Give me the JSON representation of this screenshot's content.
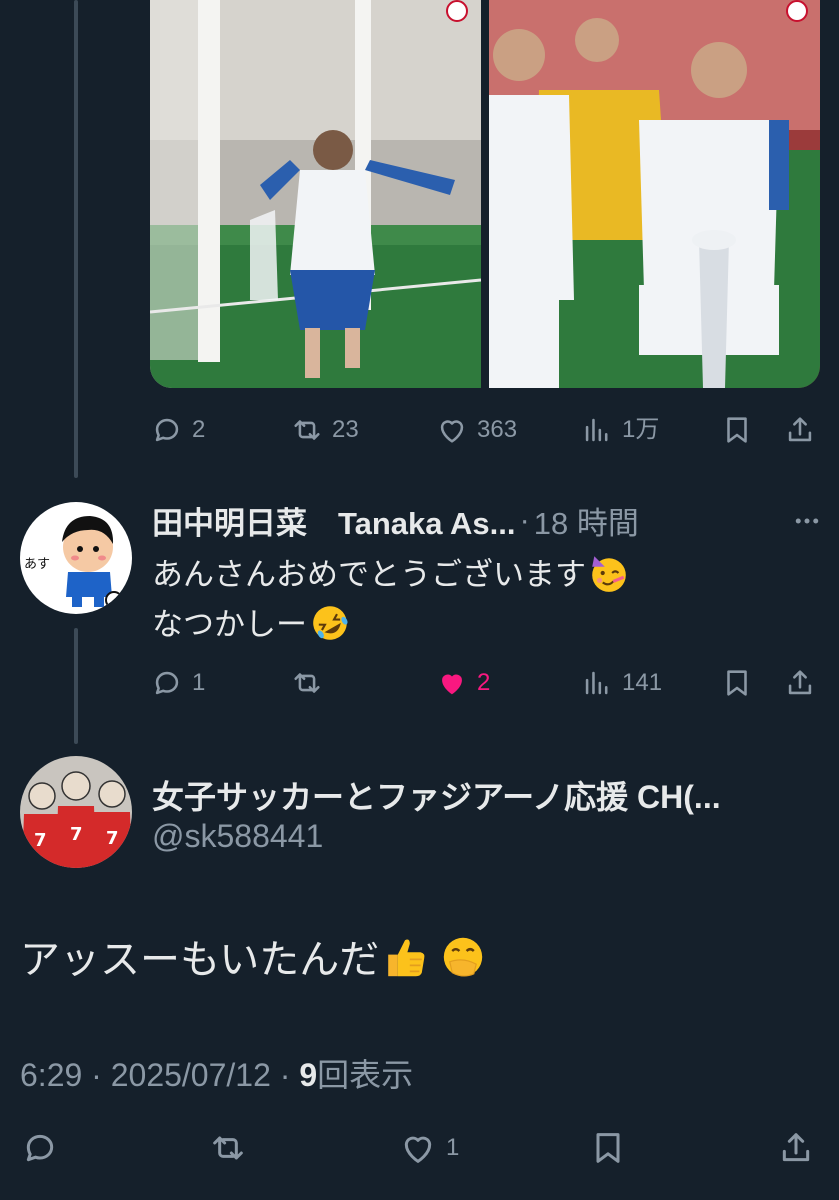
{
  "colors": {
    "background": "#15202b",
    "text": "#e7e9ea",
    "muted": "#8b98a5",
    "like": "#f91880",
    "thread_line": "#3c4a57"
  },
  "quoted_post": {
    "images": [
      "goal-celebration-photo",
      "trophy-celebration-photo"
    ],
    "actions": {
      "replies": "2",
      "reposts": "23",
      "likes": "363",
      "views": "1万"
    }
  },
  "reply": {
    "display_name": "田中明日菜　Tanaka As...",
    "separator": "·",
    "time": "18 時間",
    "avatar_text": "あす",
    "lines": [
      "あんさんおめでとうございます",
      "なつかしー"
    ],
    "emojis": [
      "partying-face",
      "rolling-on-the-floor-laughing"
    ],
    "actions": {
      "replies": "1",
      "reposts": "",
      "likes": "2",
      "views": "141"
    },
    "liked": true
  },
  "main_post": {
    "display_name": "女子サッカーとファジアーノ応援 CH(...",
    "handle": "@sk588441",
    "text": "アッスーもいたんだ",
    "emojis": [
      "thumbs-up",
      "face-with-hand-over-mouth"
    ],
    "time": "6:29",
    "date": "2025/07/12",
    "separator": "·",
    "view_count": "9",
    "view_label": "回表示",
    "actions": {
      "replies": "",
      "reposts": "",
      "likes": "1"
    }
  }
}
